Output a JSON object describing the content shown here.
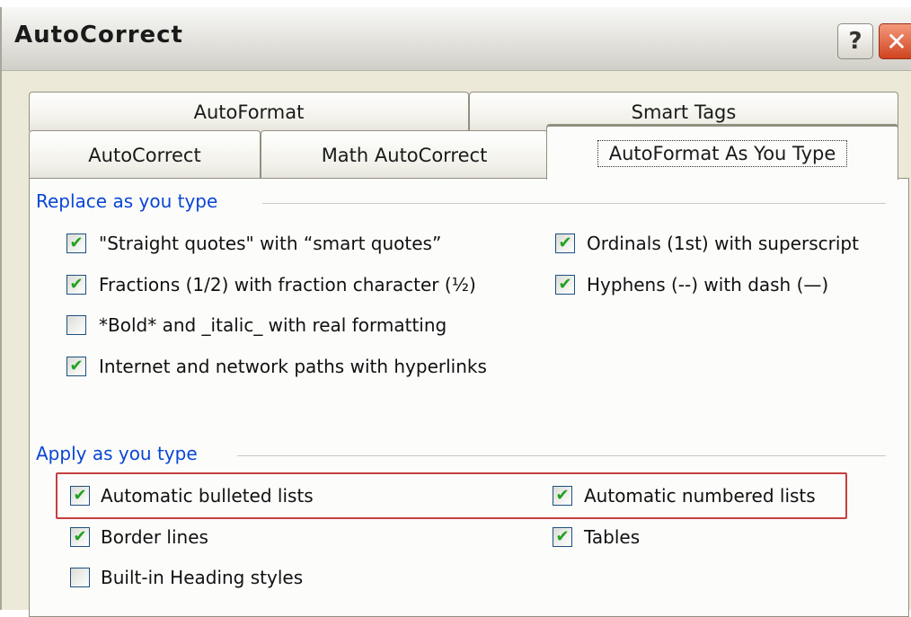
{
  "window": {
    "title": "AutoCorrect",
    "help_glyph": "?",
    "close_glyph": "✕"
  },
  "tabs": {
    "row1": [
      {
        "label": "AutoFormat"
      },
      {
        "label": "Smart Tags"
      }
    ],
    "row2": [
      {
        "label": "AutoCorrect"
      },
      {
        "label": "Math AutoCorrect"
      },
      {
        "label": "AutoFormat As You Type",
        "active": true
      }
    ]
  },
  "replace_group": {
    "title": "Replace as you type",
    "options": [
      {
        "label": "\"Straight quotes\" with “smart quotes”",
        "checked": true
      },
      {
        "label": "Ordinals (1st) with superscript",
        "checked": true
      },
      {
        "label": "Fractions (1/2) with fraction character (½)",
        "checked": true
      },
      {
        "label": "Hyphens (--) with dash (—)",
        "checked": true
      },
      {
        "label": "*Bold* and _italic_ with real formatting",
        "checked": false
      },
      {
        "label": "Internet and network paths with hyperlinks",
        "checked": true
      }
    ]
  },
  "apply_group": {
    "title": "Apply as you type",
    "options": [
      {
        "label": "Automatic bulleted lists",
        "checked": true
      },
      {
        "label": "Automatic numbered lists",
        "checked": true
      },
      {
        "label": "Border lines",
        "checked": true
      },
      {
        "label": "Tables",
        "checked": true
      },
      {
        "label": "Built-in Heading styles",
        "checked": false
      }
    ]
  },
  "check_glyph": "✔",
  "colors": {
    "group_title": "#0a46d5",
    "check": "#21a121",
    "highlight": "#c44040",
    "active_tab_accent": "#f2a73a"
  }
}
